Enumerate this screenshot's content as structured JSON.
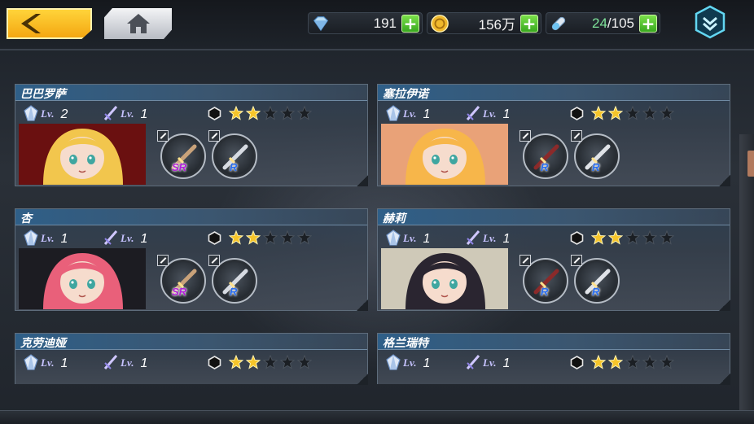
{
  "topbar": {
    "resources": [
      {
        "icon": "diamond-icon",
        "value": "191"
      },
      {
        "icon": "gold-coin-icon",
        "value": "156万"
      },
      {
        "icon": "stamina-capsule-icon",
        "value_current": "24",
        "value_sep": "/105"
      }
    ],
    "plus_label": "+"
  },
  "colors": {
    "accent_yellow": "#f4a712",
    "header_blue": "#2f5f88",
    "star_gold": "#f6c52a",
    "star_dark": "#1b1f24",
    "rarity_sr": "#b21fd8",
    "rarity_r": "#2a6ef0",
    "plus_green": "#38a81f"
  },
  "cards": [
    {
      "name": "巴巴罗萨",
      "lv_label": "Lv.",
      "lv1": "2",
      "lv2": "1",
      "stars_filled": 2,
      "stars_total": 5,
      "portrait_hair": "#f2c64d",
      "portrait_bg": "#6a1010",
      "weapons": [
        {
          "rarity": "SR"
        },
        {
          "rarity": "R"
        }
      ]
    },
    {
      "name": "塞拉伊诺",
      "lv_label": "Lv.",
      "lv1": "1",
      "lv2": "1",
      "stars_filled": 2,
      "stars_total": 5,
      "portrait_hair": "#f7b64a",
      "portrait_bg": "#e9a278",
      "weapons": [
        {
          "rarity": "R"
        },
        {
          "rarity": "R"
        }
      ]
    },
    {
      "name": "杏",
      "lv_label": "Lv.",
      "lv1": "1",
      "lv2": "1",
      "stars_filled": 2,
      "stars_total": 5,
      "portrait_hair": "#e9607a",
      "portrait_bg": "#1c1c22",
      "weapons": [
        {
          "rarity": "SR"
        },
        {
          "rarity": "R"
        }
      ]
    },
    {
      "name": "赫莉",
      "lv_label": "Lv.",
      "lv1": "1",
      "lv2": "1",
      "stars_filled": 2,
      "stars_total": 5,
      "portrait_hair": "#2a2530",
      "portrait_bg": "#cfc9b8",
      "weapons": [
        {
          "rarity": "R"
        },
        {
          "rarity": "R"
        }
      ]
    },
    {
      "name": "克劳迪娅",
      "lv_label": "Lv.",
      "lv1": "1",
      "lv2": "1",
      "stars_filled": 2,
      "stars_total": 5,
      "portrait_hair": "#3a2a24",
      "portrait_bg": "#2a2020",
      "weapons": []
    },
    {
      "name": "格兰瑞特",
      "lv_label": "Lv.",
      "lv1": "1",
      "lv2": "1",
      "stars_filled": 2,
      "stars_total": 5,
      "portrait_hair": "#1f2a2f",
      "portrait_bg": "#1a2026",
      "weapons": []
    }
  ]
}
